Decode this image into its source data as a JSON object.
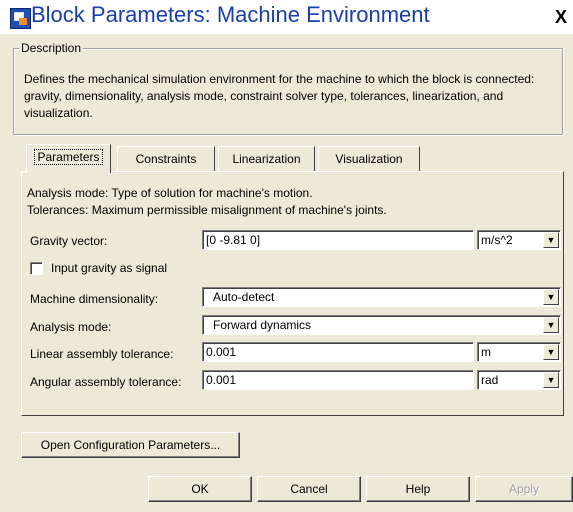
{
  "window": {
    "title": "Block Parameters: Machine Environment",
    "close_label": "X"
  },
  "description": {
    "legend": "Description",
    "text": "Defines the mechanical simulation environment for the machine to which the block is connected: gravity, dimensionality, analysis mode, constraint solver type, tolerances, linearization, and visualization."
  },
  "tabs": [
    {
      "label": "Parameters",
      "active": true
    },
    {
      "label": "Constraints",
      "active": false
    },
    {
      "label": "Linearization",
      "active": false
    },
    {
      "label": "Visualization",
      "active": false
    }
  ],
  "panel": {
    "info_line1": "Analysis mode: Type of solution for machine's motion.",
    "info_line2": "Tolerances: Maximum permissible misalignment of machine's joints.",
    "gravity": {
      "label": "Gravity vector:",
      "value": "[0 -9.81 0]",
      "unit": "m/s^2"
    },
    "input_gravity": {
      "label": "Input gravity as signal",
      "checked": false
    },
    "dimensionality": {
      "label": "Machine dimensionality:",
      "value": "Auto-detect"
    },
    "analysis_mode": {
      "label": "Analysis mode:",
      "value": "Forward dynamics"
    },
    "linear_tol": {
      "label": "Linear assembly tolerance:",
      "value": "0.001",
      "unit": "m"
    },
    "angular_tol": {
      "label": "Angular assembly tolerance:",
      "value": "0.001",
      "unit": "rad"
    }
  },
  "buttons": {
    "open_config": "Open Configuration Parameters...",
    "ok": "OK",
    "cancel": "Cancel",
    "help": "Help",
    "apply": "Apply"
  }
}
